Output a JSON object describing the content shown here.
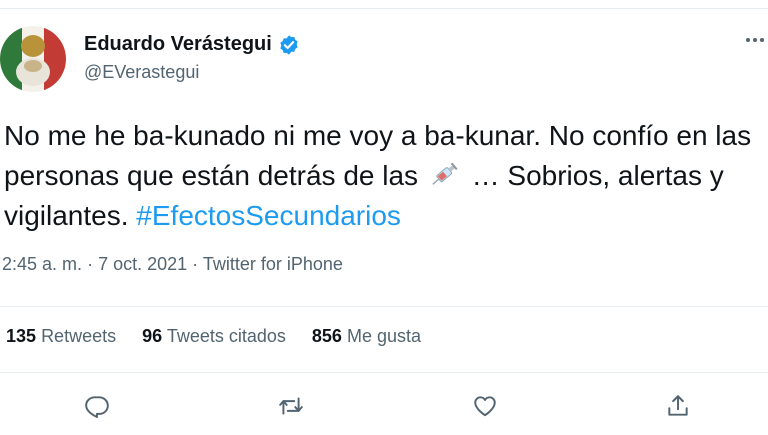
{
  "author": {
    "display_name": "Eduardo Verástegui",
    "handle": "@EVerastegui",
    "verified_icon": "verified-badge-icon",
    "avatar_colors": {
      "green": "#2f7a3a",
      "white": "#f4f1ea",
      "red": "#c23b34",
      "gold": "#b8933a"
    }
  },
  "tweet": {
    "text_before_icon": "No me he ba-kunado ni me voy a ba-kunar. No confío en las personas que están detrás de las",
    "inline_icon": "syringe-icon",
    "text_after_icon": "… Sobrios, alertas y vigilantes.",
    "hashtag": "#EfectosSecundarios"
  },
  "meta": {
    "time": "2:45 a. m.",
    "separator": "·",
    "date": "7 oct. 2021",
    "source": "Twitter for iPhone"
  },
  "stats": {
    "retweets": {
      "count": "135",
      "label": "Retweets"
    },
    "quotes": {
      "count": "96",
      "label": "Tweets citados"
    },
    "likes": {
      "count": "856",
      "label": "Me gusta"
    }
  },
  "actions": [
    {
      "name": "reply",
      "icon": "reply-icon"
    },
    {
      "name": "retweet",
      "icon": "retweet-icon"
    },
    {
      "name": "like",
      "icon": "heart-icon"
    },
    {
      "name": "share",
      "icon": "share-icon"
    }
  ],
  "colors": {
    "text": "#0f1419",
    "secondary": "#536471",
    "accent": "#1d9bf0",
    "divider": "#e6ecf0"
  }
}
